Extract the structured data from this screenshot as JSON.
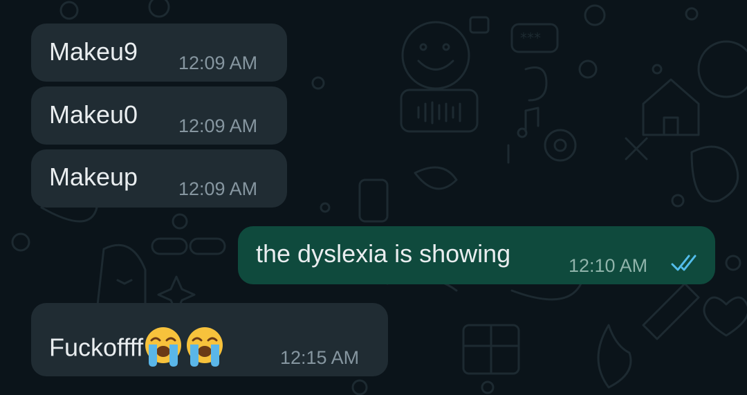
{
  "chat": {
    "background_color": "#0b141a",
    "incoming_bubble_color": "#202c33",
    "outgoing_bubble_color": "#0f4a3d",
    "read_tick_color": "#53bdeb",
    "messages": [
      {
        "direction": "incoming",
        "text": "Makeu9",
        "time": "12:09 AM"
      },
      {
        "direction": "incoming",
        "text": "Makeu0",
        "time": "12:09 AM"
      },
      {
        "direction": "incoming",
        "text": "Makeup",
        "time": "12:09 AM"
      },
      {
        "direction": "outgoing",
        "text": "the dyslexia is showing",
        "time": "12:10 AM",
        "status_icon": "double-check-read-icon"
      },
      {
        "direction": "incoming",
        "text": "Fuckoffff",
        "emojis": [
          "😭",
          "😭"
        ],
        "emoji_icon": "loudly-crying-face-icon",
        "time": "12:15 AM"
      }
    ]
  }
}
